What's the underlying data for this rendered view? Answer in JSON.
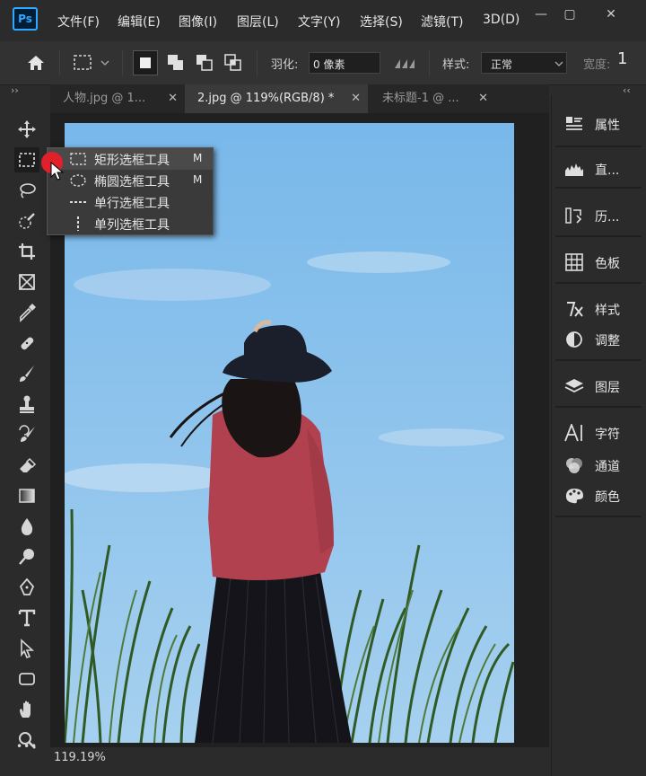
{
  "app": {
    "logo": "Ps"
  },
  "menu": [
    "文件(F)",
    "编辑(E)",
    "图像(I)",
    "图层(L)",
    "文字(Y)",
    "选择(S)",
    "滤镜(T)",
    "3D(D)"
  ],
  "window_controls": {
    "minimize": "—",
    "restore": "▢",
    "close": "✕"
  },
  "options": {
    "feather_label": "羽化:",
    "feather_value": "0 像素",
    "style_label": "样式:",
    "style_value": "正常",
    "width_label": "宽度:",
    "width_value": "1"
  },
  "tabs": [
    {
      "label": "人物.jpg @ 1...",
      "close": "✕",
      "active": false
    },
    {
      "label": "2.jpg @ 119%(RGB/8) *",
      "close": "✕",
      "active": true
    },
    {
      "label": "未标题-1 @ ...",
      "close": "✕",
      "active": false
    }
  ],
  "flyout": [
    {
      "label": "矩形选框工具",
      "shortcut": "M",
      "icon": "rect-marquee-icon"
    },
    {
      "label": "椭圆选框工具",
      "shortcut": "M",
      "icon": "ellipse-marquee-icon"
    },
    {
      "label": "单行选框工具",
      "shortcut": "",
      "icon": "single-row-marquee-icon"
    },
    {
      "label": "单列选框工具",
      "shortcut": "",
      "icon": "single-column-marquee-icon"
    }
  ],
  "right_panel": [
    {
      "label": "属性",
      "icon": "properties-icon"
    },
    {
      "label": "直...",
      "icon": "histogram-icon"
    },
    {
      "label": "历...",
      "icon": "history-icon"
    },
    {
      "label": "色板",
      "icon": "swatches-icon"
    },
    {
      "label": "样式",
      "icon": "styles-icon"
    },
    {
      "label": "调整",
      "icon": "adjustments-icon"
    },
    {
      "label": "图层",
      "icon": "layers-icon"
    },
    {
      "label": "字符",
      "icon": "character-icon"
    },
    {
      "label": "通道",
      "icon": "channels-icon"
    },
    {
      "label": "颜色",
      "icon": "color-icon"
    }
  ],
  "status": {
    "zoom": "119.19%"
  },
  "colors": {
    "sky": "#7fbbe8",
    "sweater": "#b2414f",
    "cursor_highlight": "#e0202a"
  },
  "collapse_left": "››",
  "collapse_right": "‹‹",
  "more_tools": "•••"
}
